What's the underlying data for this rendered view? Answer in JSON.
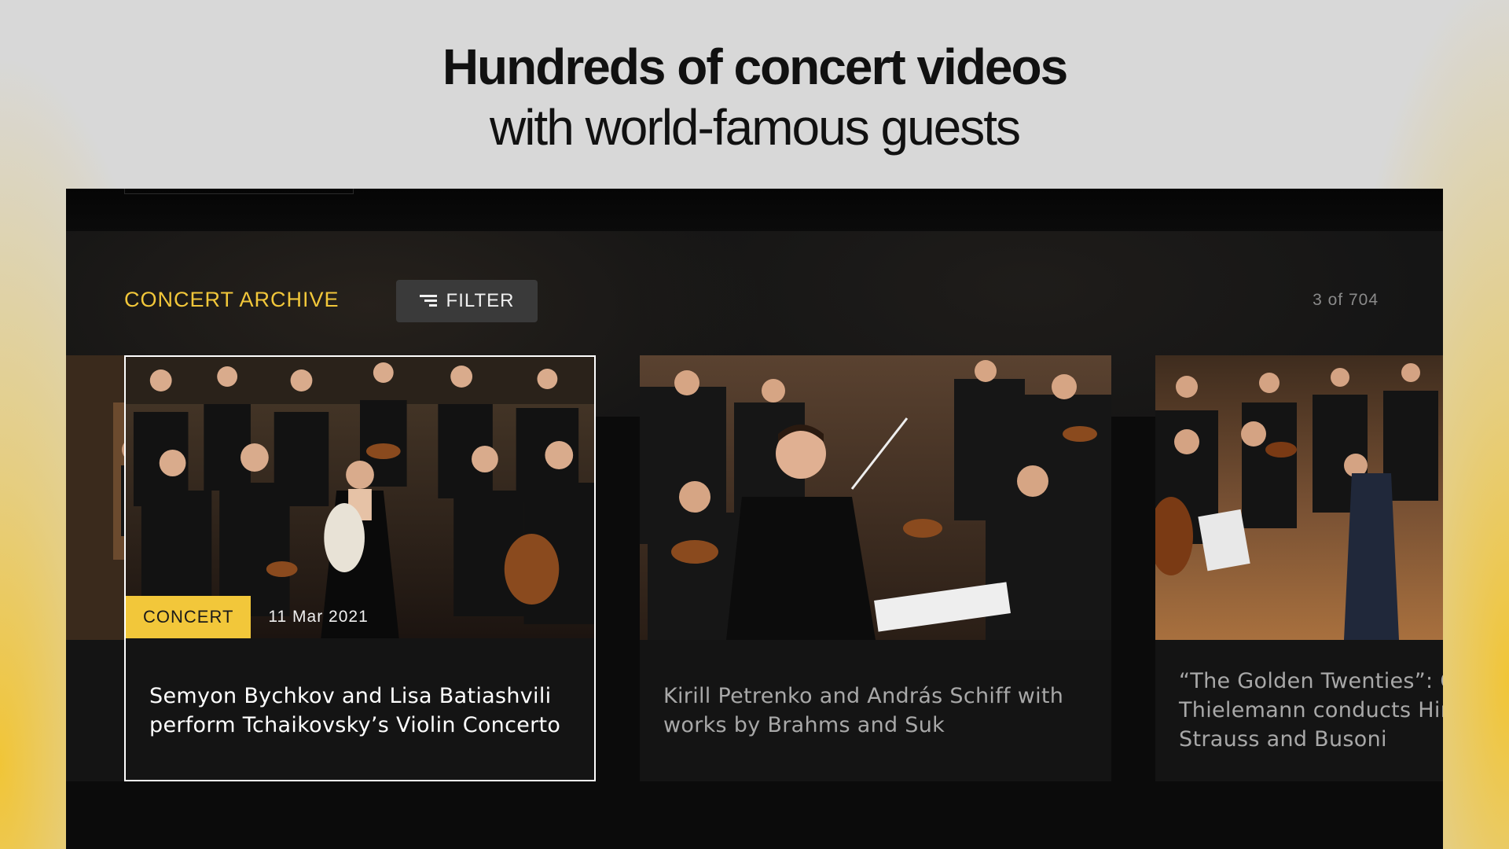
{
  "headline": {
    "line1": "Hundreds of concert videos",
    "line2": "with world-famous guests"
  },
  "archive": {
    "title": "CONCERT ARCHIVE",
    "filter_label": "FILTER",
    "counter": "3 of 704"
  },
  "cards": [
    {
      "tag": "CONCERT",
      "date": "11 Mar 2021",
      "title_line1": "Semyon Bychkov and Lisa Batiashvili",
      "title_line2": "perform Tchaikovsky’s Violin Concerto",
      "focused": true
    },
    {
      "title_line1": "Kirill Petrenko and András Schiff with",
      "title_line2": "works by Brahms and Suk"
    },
    {
      "title_line1": "“The Golden Twenties”: C",
      "title_line2": "Thielemann conducts Hin",
      "title_line3": "Strauss and Busoni"
    }
  ],
  "colors": {
    "accent": "#f2c73a",
    "background": "#0b0b0b",
    "card": "#141414"
  }
}
